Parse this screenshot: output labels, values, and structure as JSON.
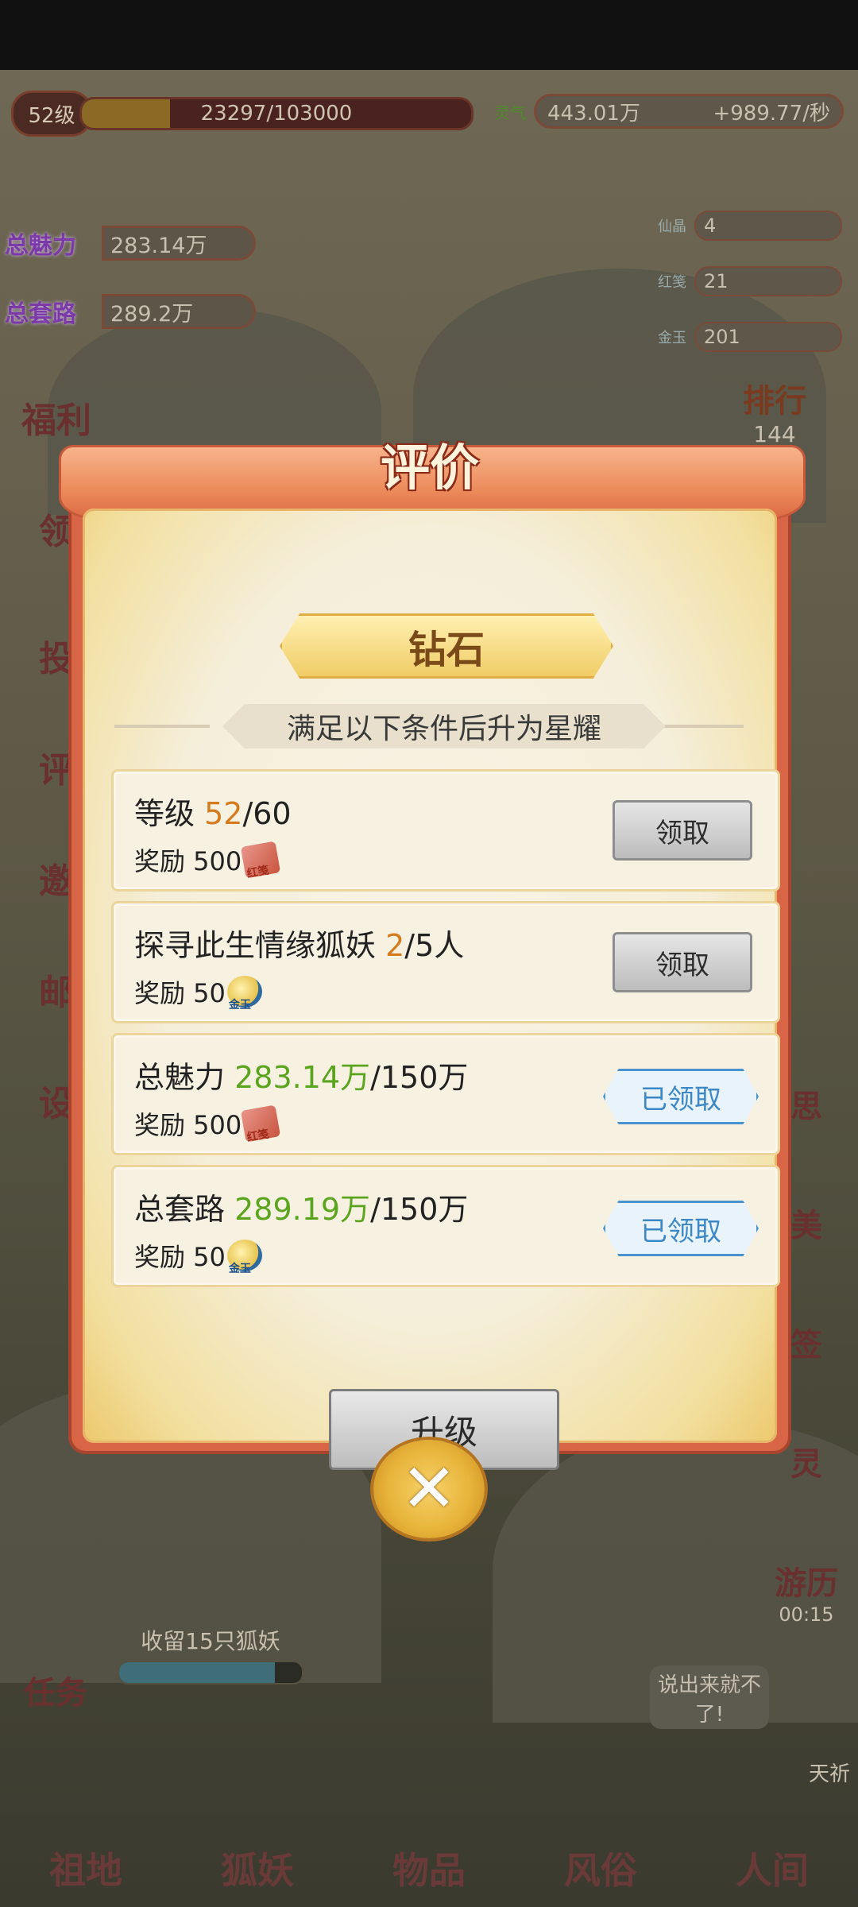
{
  "hud": {
    "level": "52级",
    "exp": "23297/103000",
    "exp_progress": 0.226,
    "charm_label": "总魅力",
    "charm_value": "283.14万",
    "routine_label": "总套路",
    "routine_value": "289.2万",
    "spirit_label": "灵气",
    "spirit_value": "443.01万",
    "spirit_rate": "+989.77/秒",
    "resources": [
      {
        "label": "仙晶",
        "value": "4"
      },
      {
        "label": "红笺",
        "value": "21"
      },
      {
        "label": "金玉",
        "value": "201"
      }
    ],
    "left_menu": [
      "福利",
      "领",
      "投",
      "评",
      "邀",
      "邮",
      "设"
    ],
    "rank_label": "排行",
    "rank_value": "144",
    "right_items": [
      "思",
      "美",
      "签",
      "灵"
    ],
    "travel_label": "游历",
    "travel_time": "00:15",
    "task_label": "任务",
    "task_bar_label": "收留15只狐妖",
    "task_progress": 0.85,
    "chat_text": "说出来就不了!",
    "pray_text": "天祈",
    "bottom_nav": [
      "祖地",
      "狐妖",
      "物品",
      "风俗",
      "人间"
    ]
  },
  "dialog": {
    "title": "评价",
    "rank": "钻石",
    "subtitle": "满足以下条件后升为星耀",
    "conditions": [
      {
        "label": "等级 ",
        "current": "52",
        "target": "/60",
        "reward_label": "奖励 500",
        "reward_icon": "redpacket-icon",
        "button": "领取",
        "claimed": false
      },
      {
        "label": "探寻此生情缘狐妖 ",
        "current": "2",
        "target": "/5人",
        "reward_label": "奖励 50",
        "reward_icon": "jade-icon",
        "button": "领取",
        "claimed": false
      },
      {
        "label": "总魅力 ",
        "current": "283.14万",
        "target": "/150万",
        "reward_label": "奖励 500",
        "reward_icon": "redpacket-icon",
        "button": "已领取",
        "claimed": true
      },
      {
        "label": "总套路 ",
        "current": "289.19万",
        "target": "/150万",
        "reward_label": "奖励 50",
        "reward_icon": "jade-icon",
        "button": "已领取",
        "claimed": true
      }
    ],
    "upgrade_button": "升级",
    "close_icon": "close-icon"
  },
  "colors": {
    "frame": "#d86646",
    "progress_orange": "#d57b1e",
    "progress_green": "#5aa41e",
    "claimed_blue": "#3c88c6"
  }
}
